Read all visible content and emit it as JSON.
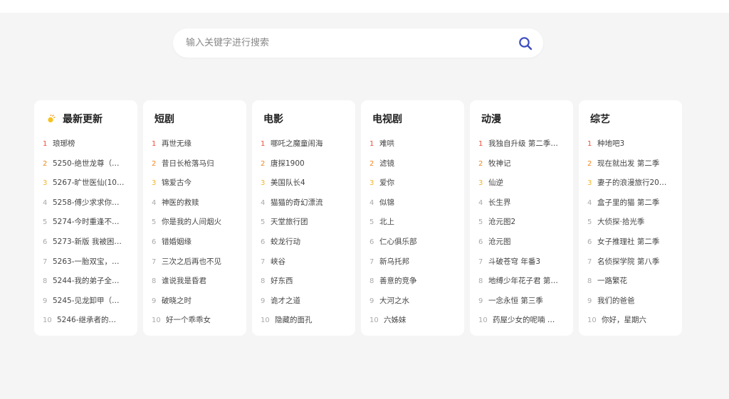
{
  "search": {
    "placeholder": "输入关键字进行搜索",
    "value": "",
    "icon": "search-icon",
    "accent": "#3b4cc0"
  },
  "rank_colors": [
    "#ee4d3a",
    "#f08a24",
    "#f3b52b"
  ],
  "columns": [
    {
      "title": "最新更新",
      "icon": "sun-icon",
      "items": [
        "琅琊榜",
        "5250-绝世龙尊（…",
        "5267-旷世医仙(10…",
        "5258-傅少求求你…",
        "5274-今时重逢不…",
        "5273-新版 我被困…",
        "5263-一胎双宝，…",
        "5244-我的弟子全…",
        "5245-见龙卸甲（…",
        "5246-继承者的…"
      ]
    },
    {
      "title": "短剧",
      "items": [
        "再世无缘",
        "昔日长枪落马归",
        "锦爱古今",
        "神医的救赎",
        "你是我的人间烟火",
        "错婚姻缘",
        "三次之后再也不见",
        "谁说我是昏君",
        "破晓之时",
        "好一个乖乖女"
      ]
    },
    {
      "title": "电影",
      "items": [
        "哪吒之魔童闹海",
        "唐探1900",
        "美国队长4",
        "猫猫的奇幻漂流",
        "天堂旅行团",
        "蛟龙行动",
        "峡谷",
        "好东西",
        "诡才之道",
        "隐藏的面孔"
      ]
    },
    {
      "title": "电视剧",
      "items": [
        "难哄",
        "滤镜",
        "爱你",
        "似锦",
        "北上",
        "仁心俱乐部",
        "新乌托邦",
        "善意的竞争",
        "大河之水",
        "六姊妹"
      ]
    },
    {
      "title": "动漫",
      "items": [
        "我独自升级 第二季…",
        "牧神记",
        "仙逆",
        "长生界",
        "沧元图2",
        "沧元图",
        "斗破苍穹 年番3",
        "地缚少年花子君 第…",
        "一念永恒 第三季",
        "药屋少女的呢喃 …"
      ]
    },
    {
      "title": "综艺",
      "items": [
        "种地吧3",
        "现在就出发 第二季",
        "妻子的浪漫旅行20…",
        "盒子里的猫 第二季",
        "大侦探·拾光季",
        "女子推理社 第二季",
        "名侦探学院 第八季",
        "一路繁花",
        "我们的爸爸",
        "你好，星期六"
      ]
    }
  ]
}
